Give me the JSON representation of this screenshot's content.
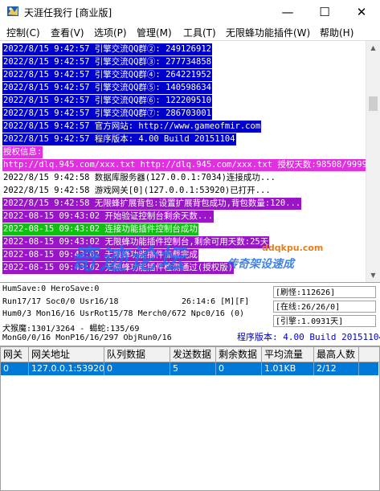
{
  "window": {
    "title": "天涯任我行 [商业版]",
    "buttons": [
      "—",
      "☐",
      "✕"
    ]
  },
  "menu": [
    "控制(C)",
    "查看(V)",
    "选项(P)",
    "管理(M)",
    "工具(T)",
    "无限蜂功能插件(W)",
    "帮助(H)"
  ],
  "log": [
    {
      "text": "2022/8/15 9:42:57 引擎交流QQ群②: 249126912",
      "bg": "#0000cc",
      "fg": "#ffffff"
    },
    {
      "text": "2022/8/15 9:42:57 引擎交流QQ群③: 277734858",
      "bg": "#0000cc",
      "fg": "#ffffff"
    },
    {
      "text": "2022/8/15 9:42:57 引擎交流QQ群④: 264221952",
      "bg": "#0000cc",
      "fg": "#ffffff"
    },
    {
      "text": "2022/8/15 9:42:57 引擎交流QQ群⑤: 140598634",
      "bg": "#0000cc",
      "fg": "#ffffff"
    },
    {
      "text": "2022/8/15 9:42:57 引擎交流QQ群⑥: 122209510",
      "bg": "#0000cc",
      "fg": "#ffffff"
    },
    {
      "text": "2022/8/15 9:42:57 引擎交流QQ群⑦: 286703001",
      "bg": "#0000cc",
      "fg": "#ffffff"
    },
    {
      "text": "2022/8/15 9:42:57 官方网站: http://www.gameofmir.com",
      "bg": "#0000cc",
      "fg": "#ffffff"
    },
    {
      "text": "2022/8/15 9:42:57 程序版本: 4.00 Build 20151104",
      "bg": "#0000cc",
      "fg": "#ffffff"
    },
    {
      "text": "授权信息:",
      "bg": "#e030e0",
      "fg": "#ffffff"
    },
    {
      "text": "http://dlq.945.com/xxx.txt http://dlq.945.com/xxx.txt 授权天数:98508/99999",
      "bg": "#e030e0",
      "fg": "#ffffff"
    },
    {
      "text": "2022/8/15 9:42:58 数据库服务器(127.0.0.1:7034)连接成功...",
      "bg": "#ffffff",
      "fg": "#000000"
    },
    {
      "text": "2022/8/15 9:42:58 游戏网关[0](127.0.0.1:53920)已打开...",
      "bg": "#ffffff",
      "fg": "#000000"
    },
    {
      "text": "2022/8/15 9:42:58 无限蜂扩展背包:设置扩展背包成功,背包数量:120...",
      "bg": "#9a14c8",
      "fg": "#ffffff"
    },
    {
      "text": "2022-08-15 09:43:02 开始验证控制台剩余天数...",
      "bg": "#9a14c8",
      "fg": "#ffffff"
    },
    {
      "text": "2022-08-15 09:43:02 连接功能插件控制台成功",
      "bg": "#10c010",
      "fg": "#ffffff"
    },
    {
      "text": "2022-08-15 09:43:02 无限蜂功能插件控制台,剩余可用天数:25天",
      "bg": "#9a14c8",
      "fg": "#ffffff"
    },
    {
      "text": "2022-08-15 09:43:02 无限蜂功能插件加载完成",
      "bg": "#9a14c8",
      "fg": "#ffffff"
    },
    {
      "text": "2022-08-15 09:43:02 无限蜂功能插件检测通过(授权版)",
      "bg": "#9a14c8",
      "fg": "#ffffff"
    }
  ],
  "status": {
    "line1": "HumSave:0 HeroSave:0",
    "line2": "Run17/17 Soc0/0 Usr16/18",
    "time": "26:14:6 [M][F]",
    "line3": "Hum0/3 Mon16/16 UsrRot15/78 Merch0/672 Npc0/16 (0)",
    "line4": "犬猴魔:1301/3264 - 蝎蛇:135/69",
    "line5": "MonG0/0/16 MonP16/16/297 ObjRun0/16",
    "box1": "[刷怪:112626]",
    "box2": "[在线:26/26/0]",
    "box3": "[引擎:1.0931天]",
    "version": "程序版本: 4.00 Build 20151104"
  },
  "grid": {
    "headers": [
      "网关",
      "网关地址",
      "队列数据",
      "发送数据",
      "剩余数据",
      "平均流量",
      "最高人数"
    ],
    "rows": [
      [
        "0",
        "127.0.0.1:53920",
        "0",
        "5",
        "0",
        "1.01KB",
        "2/12"
      ]
    ]
  },
  "watermark": {
    "main": "奇迹论坛",
    "sub": "传奇架设速成",
    "site": "ddqkpu.com"
  }
}
